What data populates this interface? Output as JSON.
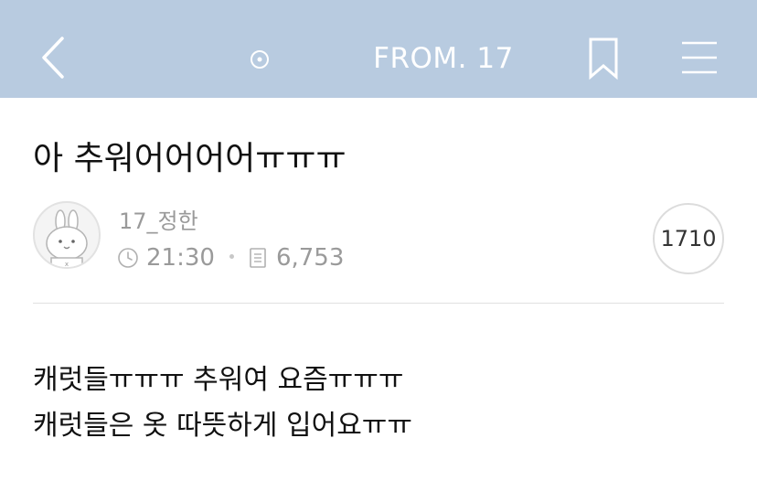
{
  "header": {
    "title": "FROM. 17",
    "back_icon": "chevron-left-icon",
    "dot_icon": "circle-dot-icon",
    "bookmark_icon": "bookmark-icon",
    "menu_icon": "hamburger-menu-icon",
    "background_color": "#b8cbe0"
  },
  "post": {
    "title": "아 추워어어어어ㅠㅠㅠ",
    "author": "17_정한",
    "time": "21:30",
    "views": "6,753",
    "count": "1710",
    "time_icon": "clock-icon",
    "views_icon": "document-icon",
    "avatar_icon": "rabbit-avatar-icon",
    "body": [
      "캐럿들ㅠㅠㅠ 추워여 요즘ㅠㅠㅠ",
      "캐럿들은 옷 따뜻하게 입어요ㅠㅠ"
    ]
  }
}
